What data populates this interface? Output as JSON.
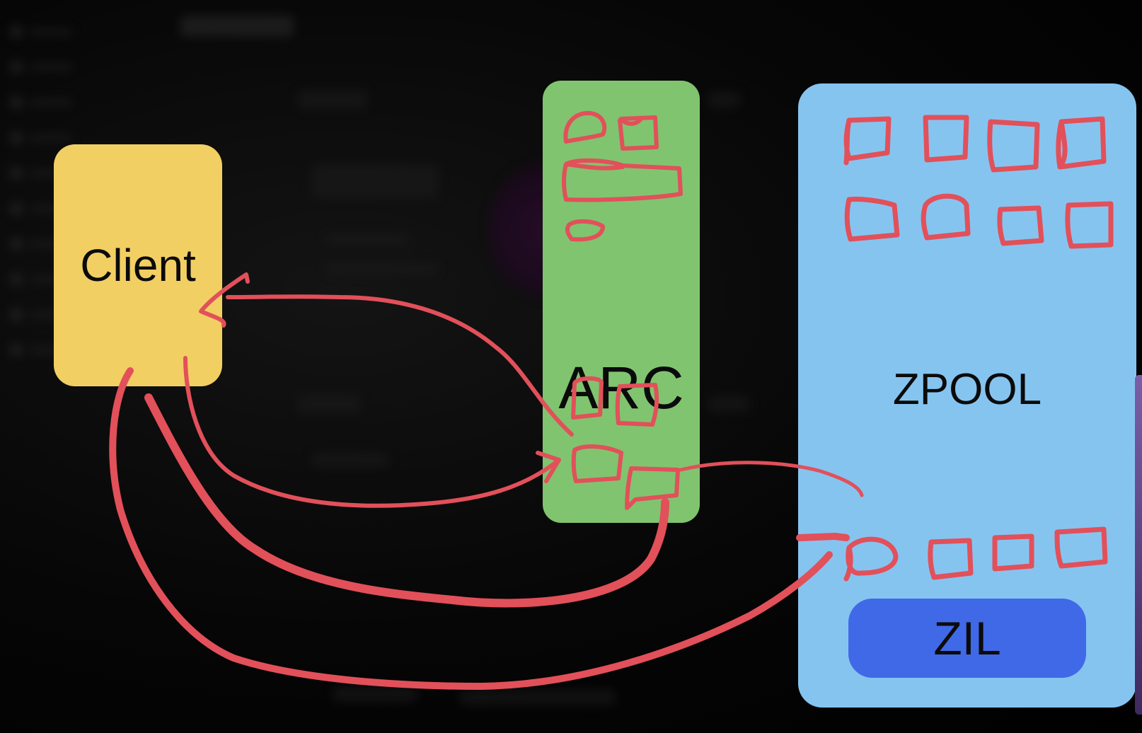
{
  "diagram": {
    "nodes": {
      "client": {
        "label": "Client"
      },
      "arc": {
        "label": "ARC"
      },
      "zpool": {
        "label": "ZPOOL"
      },
      "zil": {
        "label": "ZIL"
      }
    }
  },
  "colors": {
    "client_fill": "#f2cf63",
    "arc_fill": "#80c46f",
    "zpool_fill": "#86c4f0",
    "zil_fill": "#4069e8",
    "ink": "#e2505a",
    "background": "#000000"
  }
}
